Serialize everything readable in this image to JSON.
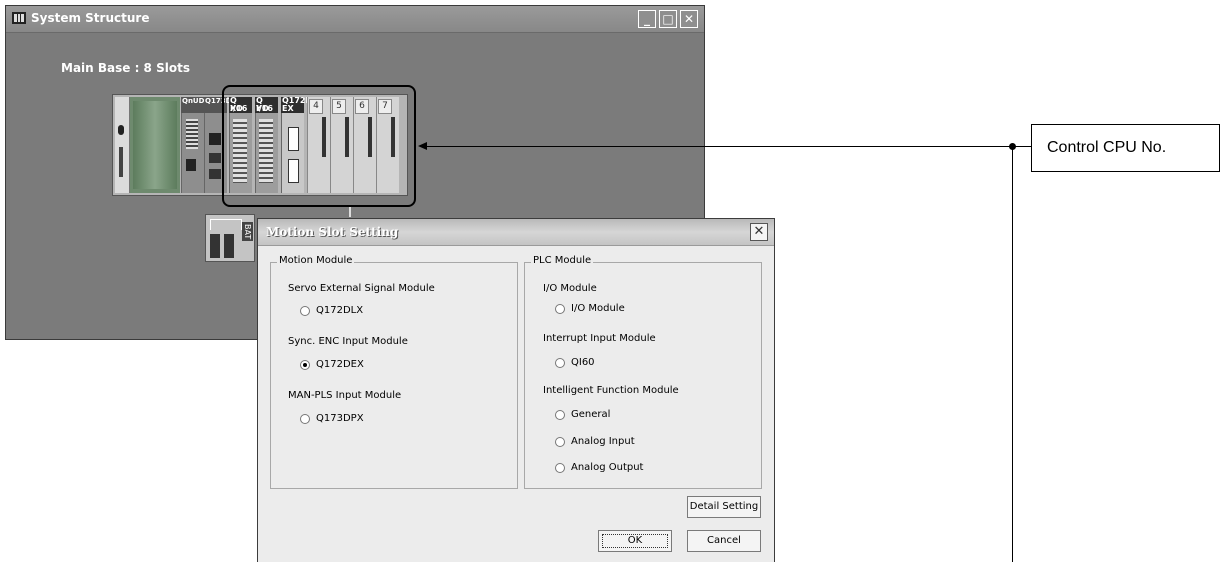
{
  "window": {
    "title": "System Structure",
    "subtitle": "Main Base : 8 Slots",
    "minimize": "_",
    "maximize": "□",
    "close": "✕"
  },
  "rack": {
    "cpu_labels": [
      "QnUD",
      "Q173D"
    ],
    "slots": [
      {
        "line1": "Q I/O",
        "line2": "X16"
      },
      {
        "line1": "Q I/O",
        "line2": "Y16"
      },
      {
        "line1": "Q172D",
        "line2": "EX"
      }
    ],
    "empty_slots": [
      "4",
      "5",
      "6",
      "7"
    ],
    "battery_label": "BAT"
  },
  "dialog": {
    "title": "Motion Slot Setting",
    "close": "✕",
    "motion_group": {
      "legend": "Motion Module",
      "sections": [
        {
          "label": "Servo External Signal Module",
          "option": "Q172DLX",
          "checked": false
        },
        {
          "label": "Sync. ENC Input Module",
          "option": "Q172DEX",
          "checked": true
        },
        {
          "label": "MAN-PLS Input Module",
          "option": "Q173DPX",
          "checked": false
        }
      ]
    },
    "plc_group": {
      "legend": "PLC Module",
      "io_label": "I/O Module",
      "io_option": "I/O Module",
      "interrupt_label": "Interrupt Input Module",
      "interrupt_option": "QI60",
      "intelligent_label": "Intelligent Function Module",
      "intelligent_options": [
        "General",
        "Analog Input",
        "Analog Output"
      ]
    },
    "detail_button": "Detail Setting",
    "ok_button": "OK",
    "cancel_button": "Cancel"
  },
  "callout": {
    "text": "Control CPU No."
  }
}
